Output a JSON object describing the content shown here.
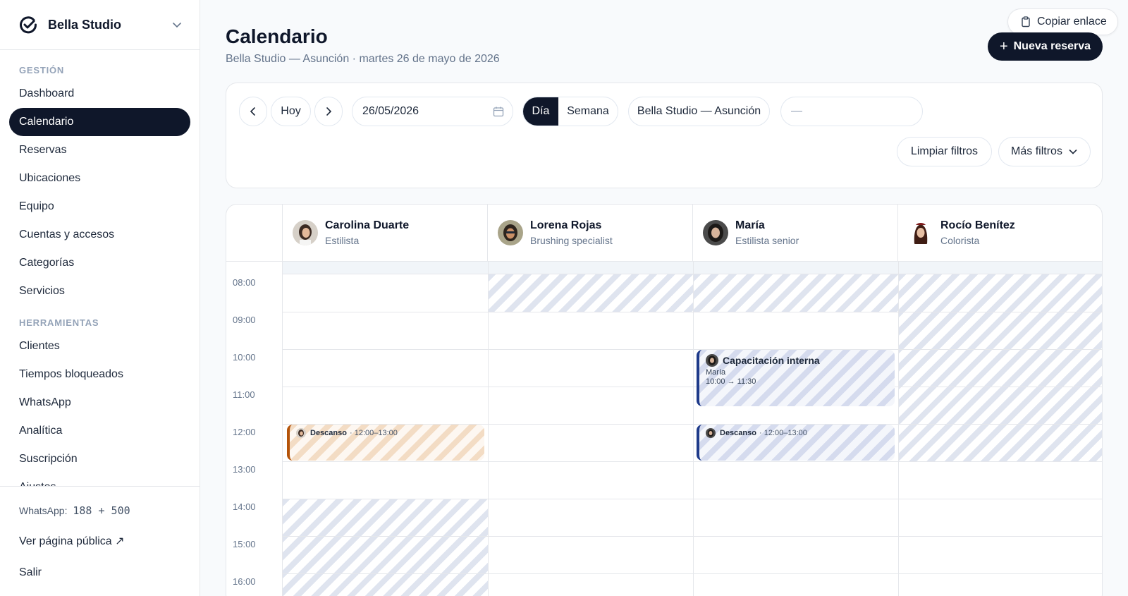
{
  "sidebar": {
    "brand": "Bella Studio",
    "section_gestion": "GESTIÓN",
    "items_gestion": [
      "Dashboard",
      "Calendario",
      "Reservas",
      "Ubicaciones",
      "Equipo",
      "Cuentas y accesos",
      "Categorías",
      "Servicios"
    ],
    "section_herramientas": "HERRAMIENTAS",
    "items_herramientas": [
      "Clientes",
      "Tiempos bloqueados",
      "WhatsApp",
      "Analítica",
      "Suscripción",
      "Ajustes"
    ],
    "whatsapp_label": "WhatsApp:",
    "whatsapp_value": "188 + 500",
    "public_page": "Ver página pública ↗",
    "logout": "Salir"
  },
  "header": {
    "title": "Calendario",
    "subtitle": "Bella Studio — Asunción · martes 26 de mayo de 2026",
    "copy_link": "Copiar enlace",
    "new_reservation": "Nueva reserva"
  },
  "filters": {
    "today": "Hoy",
    "date": "26/05/2026",
    "view_day": "Día",
    "view_week": "Semana",
    "location": "Bella Studio — Asunción",
    "staff_placeholder": "—",
    "clear": "Limpiar filtros",
    "more": "Más filtros"
  },
  "calendar": {
    "hours": [
      "08:00",
      "09:00",
      "10:00",
      "11:00",
      "12:00",
      "13:00",
      "14:00",
      "15:00",
      "16:00"
    ],
    "staff": [
      {
        "name": "Carolina Duarte",
        "role": "Estilista"
      },
      {
        "name": "Lorena Rojas",
        "role": "Brushing specialist"
      },
      {
        "name": "María",
        "role": "Estilista senior"
      },
      {
        "name": "Rocío Benítez",
        "role": "Colorista"
      }
    ],
    "events": {
      "carolina_break": {
        "title": "Descanso",
        "time": "· 12:00–13:00"
      },
      "maria_training": {
        "title": "Capacitación interna",
        "person": "María",
        "time": "10:00 → 11:30"
      },
      "maria_break": {
        "title": "Descanso",
        "time": "· 12:00–13:00"
      }
    }
  },
  "colors": {
    "accent": "#0f172a",
    "event_blue": "#1e3a8a",
    "event_orange": "#b45309"
  }
}
